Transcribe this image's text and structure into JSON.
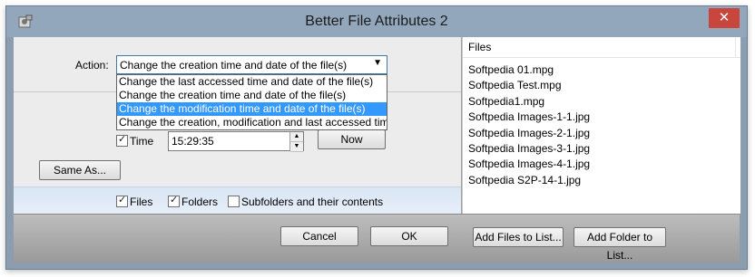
{
  "window": {
    "title": "Better File Attributes 2",
    "close_symbol": "✕"
  },
  "action": {
    "label": "Action:",
    "selected": "Change the creation time and date of the file(s)",
    "options": [
      "Change the last accessed time and date of the file(s)",
      "Change the creation time and date of the file(s)",
      "Change the modification time and date of the file(s)",
      "Change the creation, modification and last accessed time and"
    ],
    "highlighted_index": 2
  },
  "time": {
    "label": "Time",
    "checked": true,
    "value": "15:29:35"
  },
  "buttons": {
    "now": "Now",
    "same_as": "Same As...",
    "cancel": "Cancel",
    "ok": "OK",
    "add_files": "Add Files to List...",
    "add_folder": "Add Folder to List..."
  },
  "options": {
    "files": {
      "label": "Files",
      "checked": true
    },
    "folders": {
      "label": "Folders",
      "checked": true
    },
    "subfolders": {
      "label": "Subfolders and their contents",
      "checked": false
    }
  },
  "file_list": {
    "header": "Files",
    "items": [
      "Softpedia 01.mpg",
      "Softpedia Test.mpg",
      "Softpedia1.mpg",
      "Softpedia Images-1-1.jpg",
      "Softpedia Images-2-1.jpg",
      "Softpedia Images-3-1.jpg",
      "Softpedia Images-4-1.jpg",
      "Softpedia S2P-14-1.jpg"
    ]
  },
  "colors": {
    "titlebar": "#93a7bc",
    "close": "#c9463d",
    "selection": "#3399ff"
  }
}
